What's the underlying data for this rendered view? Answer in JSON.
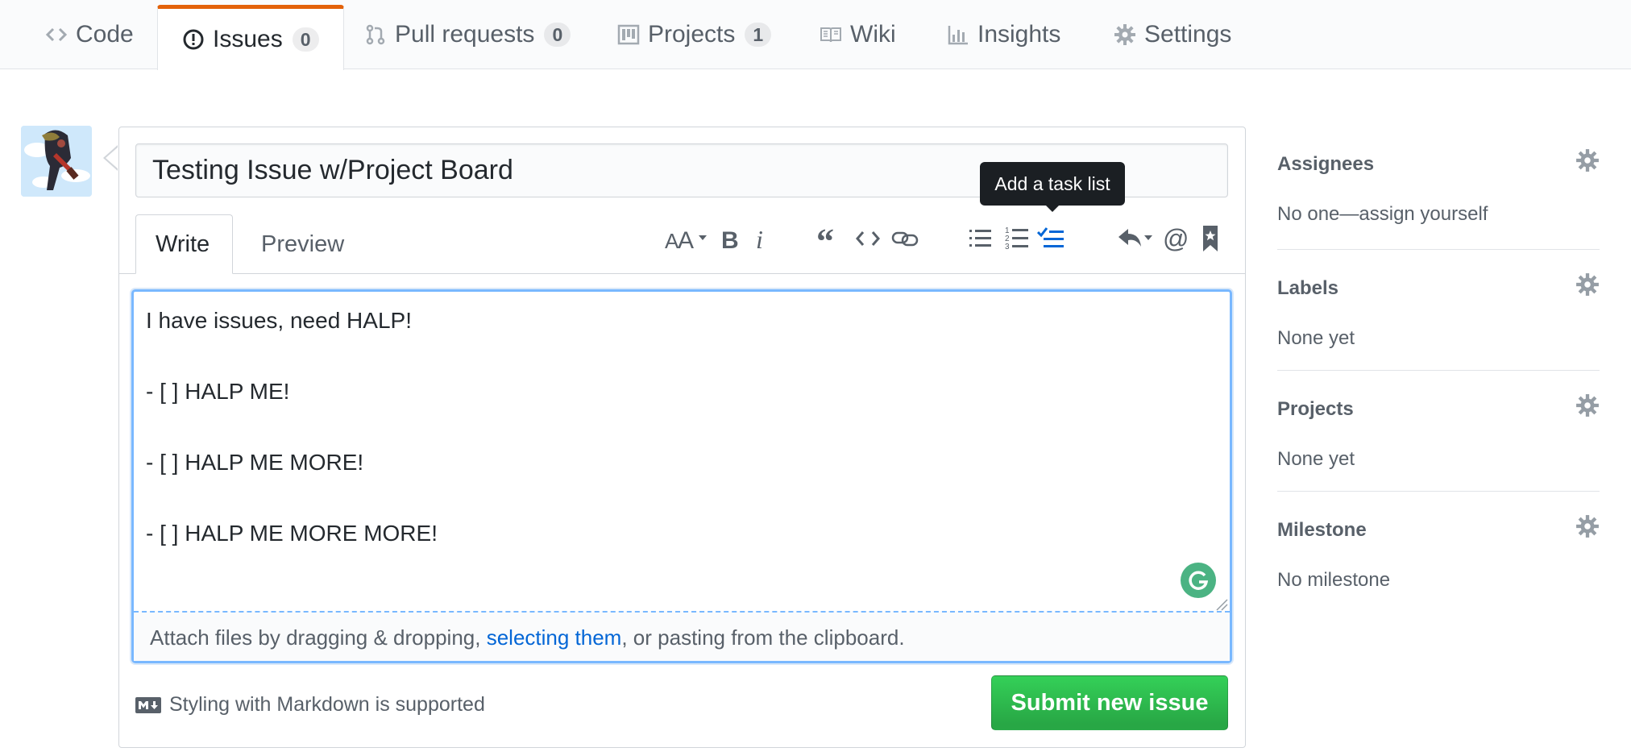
{
  "nav": {
    "tabs": [
      {
        "label": "Code",
        "icon": "code-icon"
      },
      {
        "label": "Issues",
        "count": "0",
        "icon": "issue-opened-icon"
      },
      {
        "label": "Pull requests",
        "count": "0",
        "icon": "git-pull-request-icon"
      },
      {
        "label": "Projects",
        "count": "1",
        "icon": "project-icon"
      },
      {
        "label": "Wiki",
        "icon": "book-icon"
      },
      {
        "label": "Insights",
        "icon": "graph-icon"
      },
      {
        "label": "Settings",
        "icon": "gear-icon"
      }
    ],
    "selected": "Issues",
    "accent_color": "#e36209"
  },
  "issue": {
    "title_value": "Testing Issue w/Project Board",
    "tabs": {
      "write": "Write",
      "preview": "Preview"
    },
    "toolbar": {
      "tooltip": "Add a task list",
      "tools": [
        "text-size-icon",
        "bold-icon",
        "italic-icon",
        "quote-icon",
        "code-icon",
        "link-icon",
        "unordered-list-icon",
        "ordered-list-icon",
        "task-list-icon",
        "reply-icon",
        "mention-icon",
        "bookmark-icon"
      ]
    },
    "body_lines": [
      "I have issues, need HALP!",
      "- [ ] HALP ME!",
      "- [ ] HALP ME MORE!",
      "- [ ] HALP ME MORE MORE!"
    ],
    "drop_zone": {
      "before": "Attach files by dragging & dropping, ",
      "link": "selecting them",
      "after": ", or pasting from the clipboard."
    },
    "markdown_note": "Styling with Markdown is supported",
    "submit_label": "Submit new issue",
    "submit_color": "#28a745"
  },
  "sidebar": {
    "sections": [
      {
        "title": "Assignees",
        "value": "No one—assign yourself"
      },
      {
        "title": "Labels",
        "value": "None yet"
      },
      {
        "title": "Projects",
        "value": "None yet"
      },
      {
        "title": "Milestone",
        "value": "No milestone"
      }
    ]
  }
}
